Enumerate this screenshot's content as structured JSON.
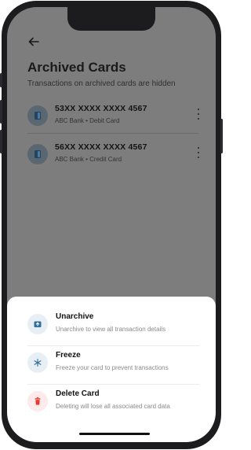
{
  "header": {
    "title": "Archived Cards",
    "subtitle": "Transactions on archived cards are hidden"
  },
  "cards": [
    {
      "number": "53XX XXXX XXXX 4567",
      "meta": "ABC Bank • Debit Card"
    },
    {
      "number": "56XX XXXX XXXX 4567",
      "meta": "ABC Bank • Credit Card"
    }
  ],
  "sheet": {
    "options": [
      {
        "title": "Unarchive",
        "desc": "Unarchive to view all transaction details",
        "icon": "unarchive-icon",
        "color": "#2f6f9a"
      },
      {
        "title": "Freeze",
        "desc": "Freeze your card to prevent transactions",
        "icon": "snowflake-icon",
        "color": "#2f6f9a"
      },
      {
        "title": "Delete Card",
        "desc": "Deleting will lose all associated card data",
        "icon": "trash-icon",
        "color": "#e53935"
      }
    ]
  }
}
